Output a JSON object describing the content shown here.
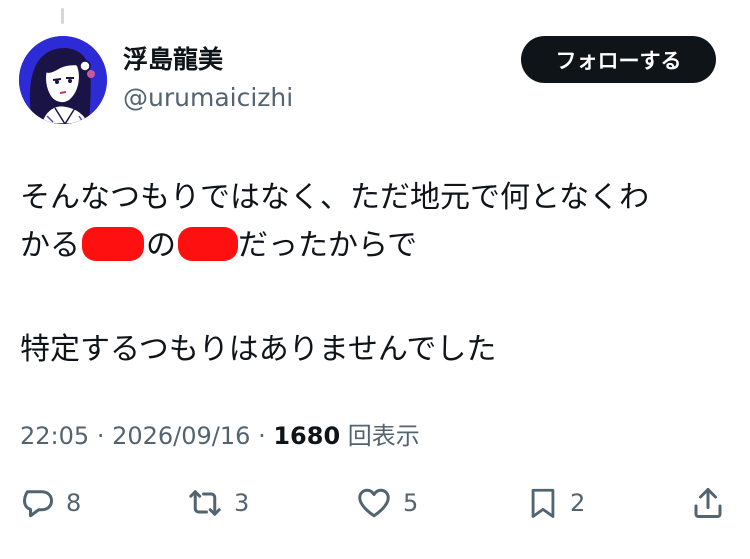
{
  "user": {
    "display_name": "浮島龍美",
    "handle": "@urumaicizhi",
    "avatar_icon": "avatar-illustration-icon"
  },
  "follow_button": {
    "label": "フォローする"
  },
  "tweet": {
    "line1": "そんなつもりではなく、ただ地元で何となくわ",
    "line2_a": "かる",
    "line2_b": "の",
    "line2_c": "だったからで",
    "line3": "特定するつもりはありませんでした"
  },
  "meta": {
    "time": "22:05",
    "sep": "·",
    "date": "2026/09/16",
    "views_count": "1680",
    "views_label": "回表示"
  },
  "actions": {
    "replies": "8",
    "retweets": "3",
    "likes": "5",
    "bookmarks": "2"
  },
  "colors": {
    "text": "#0f1419",
    "secondary": "#536471",
    "button_bg": "#0f1419",
    "redaction": "#ff1010",
    "avatar_bg": "#2d2bd6"
  }
}
